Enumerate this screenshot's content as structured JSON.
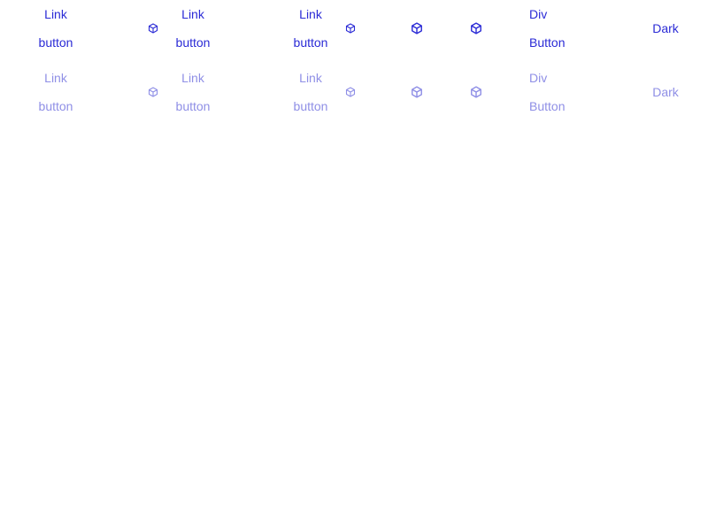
{
  "accent_color": "#2b2bd6",
  "disabled_color": "#8f8fe6",
  "rows": [
    {
      "state": "enabled",
      "items": [
        {
          "lines": [
            "Link",
            "button"
          ]
        },
        {
          "icon": "cube-icon"
        },
        {
          "lines": [
            "Link",
            "button"
          ]
        },
        {
          "lines": [
            "Link",
            "button"
          ]
        },
        {
          "icon": "cube-icon"
        },
        {
          "icon": "cube-icon"
        },
        {
          "icon": "cube-icon"
        },
        {
          "lines": [
            "Div",
            "Button"
          ]
        },
        {
          "lines": [
            "Dark"
          ]
        }
      ]
    },
    {
      "state": "disabled",
      "items": [
        {
          "lines": [
            "Link",
            "button"
          ]
        },
        {
          "icon": "cube-icon"
        },
        {
          "lines": [
            "Link",
            "button"
          ]
        },
        {
          "lines": [
            "Link",
            "button"
          ]
        },
        {
          "icon": "cube-icon"
        },
        {
          "icon": "cube-icon"
        },
        {
          "icon": "cube-icon"
        },
        {
          "lines": [
            "Div",
            "Button"
          ]
        },
        {
          "lines": [
            "Dark"
          ]
        }
      ]
    }
  ]
}
